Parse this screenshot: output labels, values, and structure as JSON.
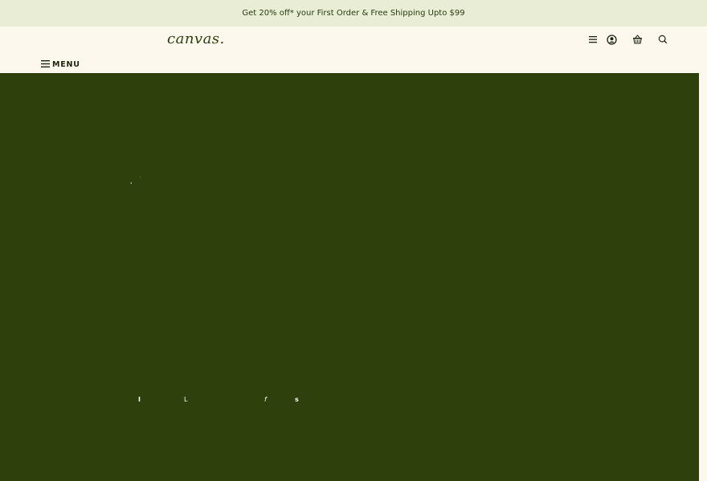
{
  "announcement": {
    "text": "Get 20% off* your First Order & Free Shipping Upto $99"
  },
  "header": {
    "logo": "canvas.",
    "menu_label": "MENU",
    "icons": [
      "hamburger-icon",
      "account-icon",
      "basket-icon",
      "search-icon"
    ]
  },
  "hero": {
    "fragments": [
      ",",
      "·",
      "I",
      "L",
      "f",
      "s"
    ]
  },
  "colors": {
    "announcement_bg": "#e9edd5",
    "header_bg": "#fdf8ee",
    "hero_bg": "#2e400b",
    "text_dark": "#1c2410"
  }
}
